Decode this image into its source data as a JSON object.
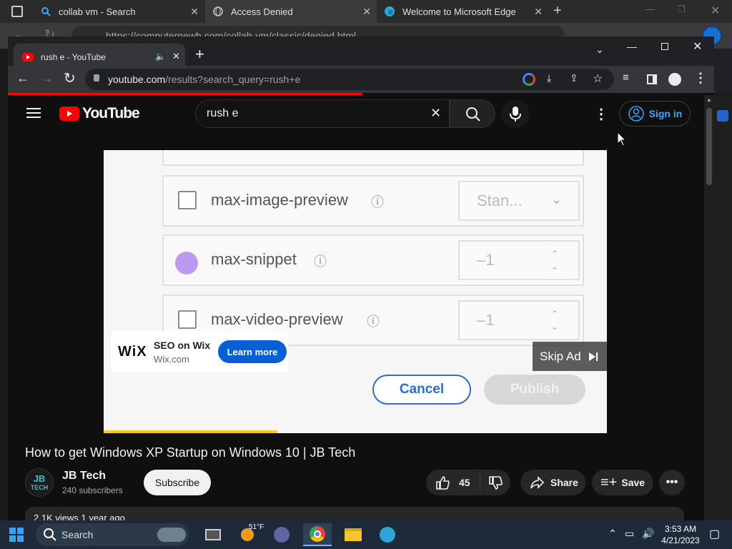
{
  "edge": {
    "tabs": [
      {
        "title": "collab vm - Search"
      },
      {
        "title": "Access Denied"
      },
      {
        "title": "Welcome to Microsoft Edge"
      }
    ],
    "address": "https://computernewb.com/collab-vm/classic/denied.html"
  },
  "chrome": {
    "tab_title": "rush e - YouTube",
    "url_domain": "youtube.com",
    "url_path": "/results?search_query=rush+e"
  },
  "youtube": {
    "logo_text": "YouTube",
    "search_value": "rush e",
    "signin_label": "Sign in"
  },
  "video": {
    "rows": [
      {
        "label": "max-image-preview",
        "value": "Stan..."
      },
      {
        "label": "max-snippet",
        "value": "–1"
      },
      {
        "label": "max-video-preview",
        "value": "–1"
      }
    ],
    "cancel_label": "Cancel",
    "publish_label": "Publish",
    "ad": {
      "brand": "WiX",
      "title": "SEO on Wix",
      "domain": "Wix.com",
      "cta": "Learn more",
      "skip": "Skip Ad",
      "progress": 0.345
    }
  },
  "watch": {
    "title": "How to get Windows XP Startup on Windows 10 | JB Tech",
    "channel": "JB Tech",
    "avatar_line1": "JB",
    "avatar_line2": "TECH",
    "subscribers": "240 subscribers",
    "subscribe_label": "Subscribe",
    "likes": "45",
    "share_label": "Share",
    "save_label": "Save",
    "desc_partial": "2.1K views  1 year ago"
  },
  "taskbar": {
    "search_label": "Search",
    "weather": "51°F",
    "time": "3:53 AM",
    "date": "4/21/2023"
  },
  "colors": {
    "yt_red": "#ff0000",
    "link_blue": "#3ea6ff",
    "ad_blue": "#065fd4"
  }
}
